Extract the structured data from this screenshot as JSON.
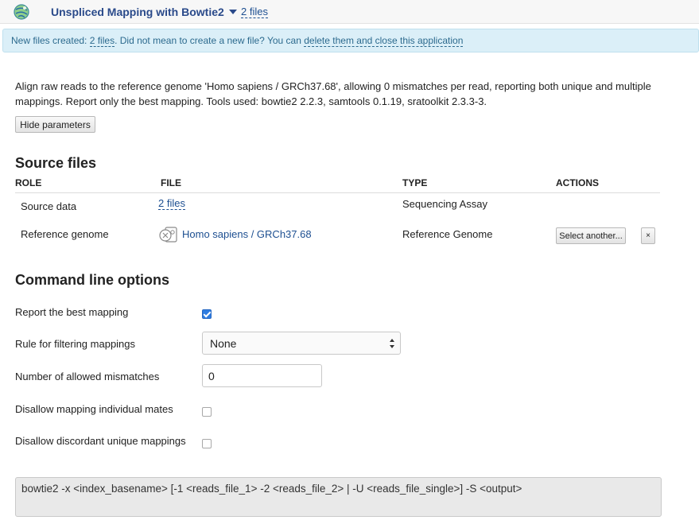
{
  "header": {
    "app_title": "Unspliced Mapping with Bowtie2",
    "files_link": "2 files"
  },
  "notice": {
    "prefix": "New files created: ",
    "files_link": "2 files",
    "middle": ". Did not mean to create a new file? You can ",
    "delete_link": "delete them and close this application"
  },
  "description": "Align raw reads to the reference genome 'Homo sapiens / GRCh37.68', allowing 0 mismatches per read, reporting both unique and multiple mappings. Report only the best mapping. Tools used: bowtie2 2.2.3, samtools 0.1.19, sratoolkit 2.3.3-3.",
  "hide_parameters_label": "Hide parameters",
  "source_files": {
    "heading": "Source files",
    "columns": [
      "ROLE",
      "FILE",
      "TYPE",
      "ACTIONS"
    ],
    "rows": [
      {
        "role": "Source data",
        "file": "2 files",
        "type": "Sequencing Assay"
      },
      {
        "role": "Reference genome",
        "file": "Homo sapiens / GRCh37.68",
        "type": "Reference Genome",
        "action_label": "Select another...",
        "remove_label": "×"
      }
    ]
  },
  "command_line_options": {
    "heading": "Command line options",
    "options": [
      {
        "label": "Report the best mapping",
        "checked": true
      },
      {
        "label": "Rule for filtering mappings",
        "value": "None"
      },
      {
        "label": "Number of allowed mismatches",
        "value": "0"
      },
      {
        "label": "Disallow mapping individual mates",
        "checked": false
      },
      {
        "label": "Disallow discordant unique mappings",
        "checked": false
      }
    ]
  },
  "command": "bowtie2  -x <index_basename> [-1 <reads_file_1> -2 <reads_file_2> | -U <reads_file_single>] -S <output>",
  "colors": {
    "link": "#1d4f91",
    "notice_bg": "#dbeff8",
    "checkbox_checked": "#2f7de1"
  },
  "icons": [
    "app-logo-icon",
    "chevron-down-icon",
    "reference-genome-icon",
    "select-arrows-icon"
  ]
}
